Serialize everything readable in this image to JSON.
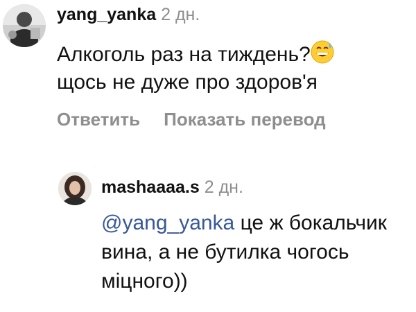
{
  "comments": [
    {
      "username": "yang_yanka",
      "time": "2 дн.",
      "text_line1": "Алкоголь раз на тиждень?",
      "emoji": "grinning-face-with-sweat",
      "text_line2": "щось не дуже про здоров'я",
      "actions": {
        "reply": "Ответить",
        "translate": "Показать перевод"
      }
    },
    {
      "username": "mashaaaa.s",
      "time": "2 дн.",
      "mention": "@yang_yanka",
      "text_rest": " це ж бокальчик вина, а не бутилка чогось міцного))"
    }
  ],
  "colors": {
    "mention": "#385898",
    "meta": "#8e8e8e"
  }
}
